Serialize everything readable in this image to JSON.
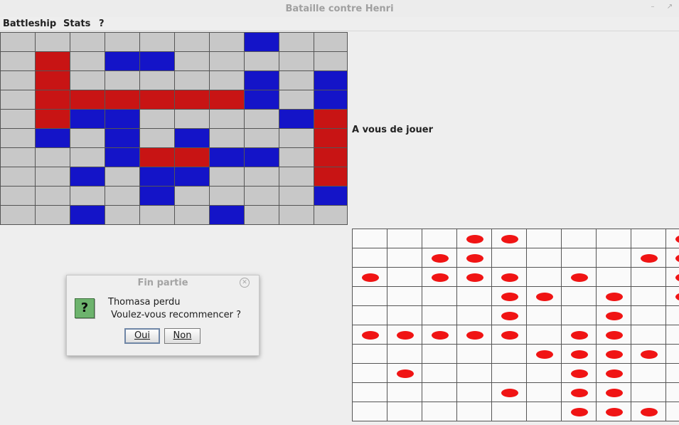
{
  "window": {
    "title": "Bataille contre Henri"
  },
  "menu": [
    "Battleship",
    "Stats",
    "?"
  ],
  "status": "A vous de jouer",
  "colors": {
    "empty": "#c8c8c8",
    "hit": "#c81414",
    "ship": "#1414c8",
    "water": "#fafafa",
    "shot": "#f01414"
  },
  "player_grid": [
    ".......b..",
    ".r.bb.....",
    ".r.....b.b",
    ".rrrrrrb.b",
    ".rbb....br",
    ".b.b.b...r",
    "...brrbb.r",
    "..b.bb...r",
    "....b....b",
    "..b...b..."
  ],
  "shots_grid": [
    "...xx....x",
    "..xx....xx",
    "x.xxx.x..x",
    "....xx.x.x",
    "....x..x..",
    "xxxxx.xx..",
    ".....xxxx.",
    ".x....xx..",
    "....x.xx..",
    "......xxx."
  ],
  "dialog": {
    "title": "Fin partie",
    "line1": "Thomasa perdu",
    "line2": " Voulez-vous recommencer ?",
    "yes": "Oui",
    "no": "Non",
    "icon": "question-icon"
  }
}
